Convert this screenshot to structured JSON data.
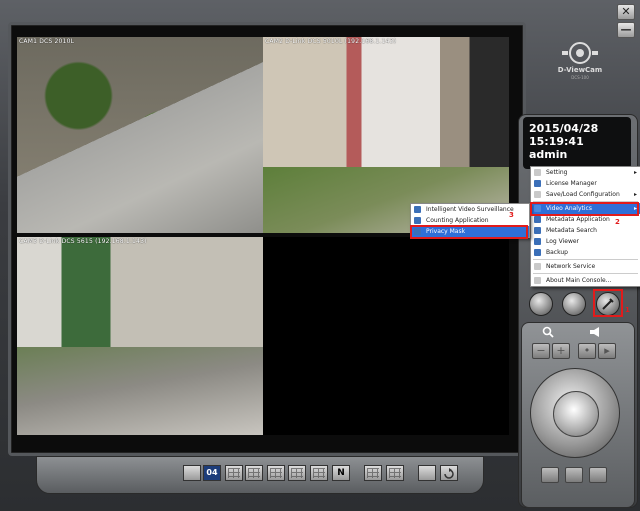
{
  "window": {
    "close_glyph": "✕",
    "minimize_glyph": "—"
  },
  "logo": {
    "name": "D-ViewCam",
    "sub": "DCS-100"
  },
  "cameras": [
    {
      "label": "CAM1 DCS 2010L"
    },
    {
      "label": "CAM2 D-Link DCS 5010L (192.168.1.143)"
    },
    {
      "label": "CAM3 D-Link DCS 5615 (192.168.1.143)"
    }
  ],
  "status": {
    "date": "2015/04/28",
    "time": "15:19:41",
    "user": "admin"
  },
  "menu": {
    "items": [
      {
        "label": "Setting",
        "has_arrow": true,
        "icon_color": "#c9c9c9"
      },
      {
        "label": "License Manager",
        "has_arrow": false,
        "icon_color": "#3b6fb8"
      },
      {
        "label": "Save/Load Configuration",
        "has_arrow": true,
        "icon_color": "#c9c9c9"
      },
      {
        "label": "Video Analytics",
        "has_arrow": true,
        "icon_color": "#4a8ae0",
        "highlighted": true
      },
      {
        "label": "Metadata Application",
        "has_arrow": false,
        "icon_color": "#3b6fb8"
      },
      {
        "label": "Metadata Search",
        "has_arrow": false,
        "icon_color": "#3b6fb8"
      },
      {
        "label": "Log Viewer",
        "has_arrow": false,
        "icon_color": "#3b6fb8"
      },
      {
        "label": "Backup",
        "has_arrow": false,
        "icon_color": "#3b6fb8"
      },
      {
        "label": "Network Service",
        "has_arrow": false,
        "icon_color": "#c9c9c9"
      },
      {
        "label": "About Main Console...",
        "has_arrow": false,
        "icon_color": "#c9c9c9"
      }
    ]
  },
  "submenu": {
    "items": [
      {
        "label": "Intelligent Video Surveillance",
        "icon_color": "#3b6fb8"
      },
      {
        "label": "Counting Application",
        "icon_color": "#3b6fb8"
      },
      {
        "label": "Privacy Mask",
        "icon_color": "#3b6fb8",
        "highlighted": true
      }
    ]
  },
  "annotations": {
    "badge1": "1",
    "badge2": "2",
    "badge3": "3"
  },
  "bottom": {
    "active_layout_label": "04",
    "n_label": "N"
  },
  "colors": {
    "highlight": "#2f6fd8",
    "annotation": "#e21b1b",
    "lcd_bg": "#0e0f10"
  }
}
